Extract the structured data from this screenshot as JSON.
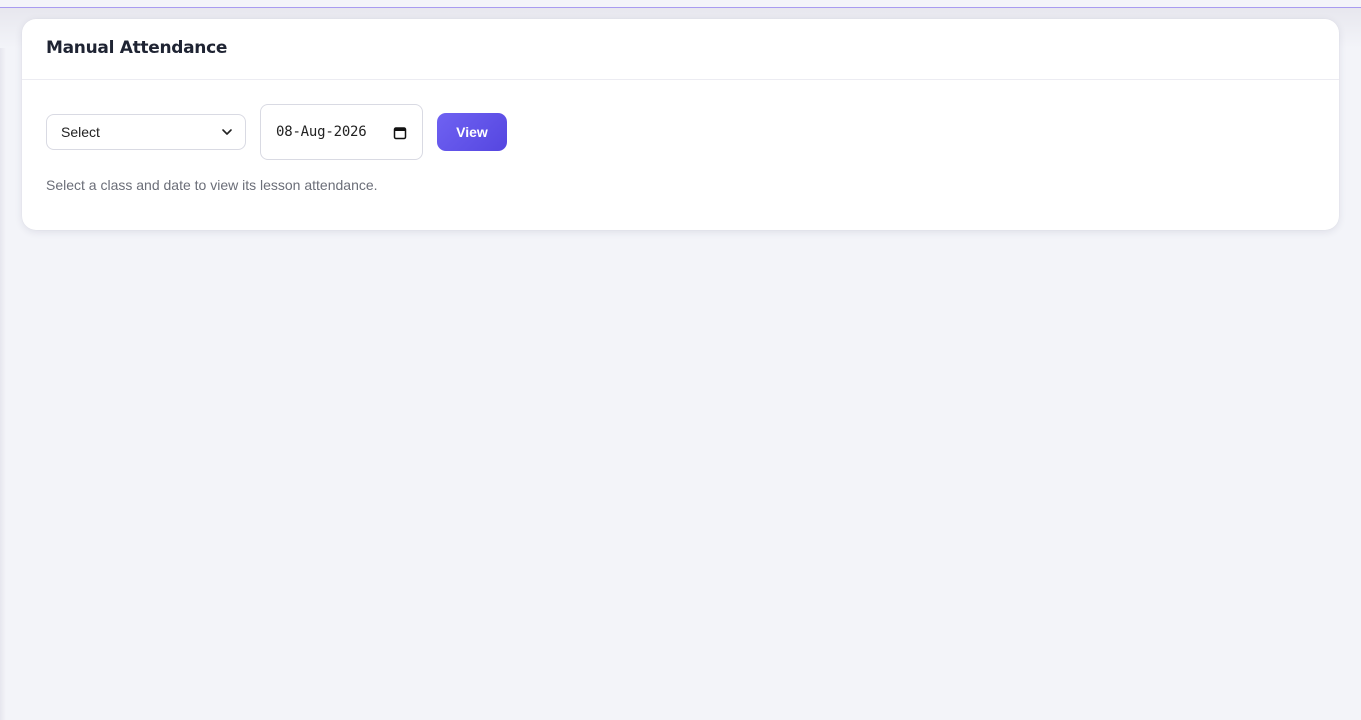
{
  "page": {
    "title": "Manual Attendance"
  },
  "filters": {
    "class_select": {
      "selected": "Select",
      "icon": "chevron-down-icon"
    },
    "date_input": {
      "value": "08-Aug-2026",
      "icon": "calendar-icon"
    },
    "view_button": {
      "label": "View"
    }
  },
  "hint": "Select a class and date to view its lesson attendance.",
  "colors": {
    "accent": "#6357ea",
    "background": "#f3f4f9",
    "title": "#1f2433",
    "hint": "#6b6e78"
  }
}
